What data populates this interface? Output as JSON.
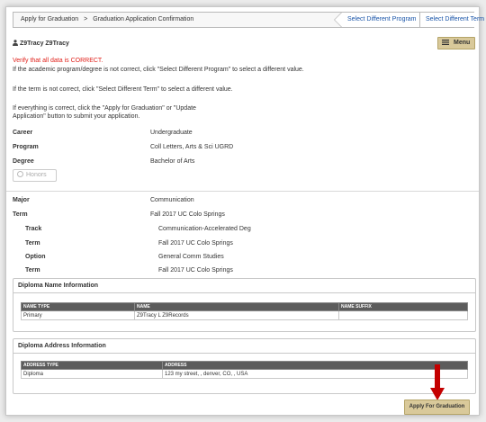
{
  "breadcrumb": {
    "parent": "Apply for Graduation",
    "separator": ">",
    "current": "Graduation Application Confirmation"
  },
  "tabs": {
    "select_program": "Select Different Program",
    "select_term": "Select Different Term"
  },
  "user": {
    "name": "Z9Tracy Z9Tracy",
    "icon": "person-icon"
  },
  "menu": {
    "label": "Menu",
    "icon": "hamburger-icon"
  },
  "messages": {
    "verify": "Verify that all data is CORRECT.",
    "program_hint": "If the academic program/degree is not correct, click \"Select Different Program\" to select a different value.",
    "term_hint": "If the term is not correct, click \"Select Different Term\" to select a different value.",
    "submit_hint_1": "If everything is correct, click the \"Apply for Graduation\" or \"Update",
    "submit_hint_2": "Application\" button to submit your application."
  },
  "program_info": {
    "career_label": "Career",
    "career_value": "Undergraduate",
    "program_label": "Program",
    "program_value": "Coll Letters, Arts & Sci UGRD",
    "degree_label": "Degree",
    "degree_value": "Bachelor of Arts"
  },
  "honors": {
    "label": "Honors"
  },
  "plan_info": {
    "major_label": "Major",
    "major_value": "Communication",
    "term_label": "Term",
    "term_value": "Fall 2017 UC Colo Springs",
    "track_label": "Track",
    "track_value": "Communication-Accelerated Deg",
    "track_term_label": "Term",
    "track_term_value": "Fall 2017 UC Colo Springs",
    "option_label": "Option",
    "option_value": "General Comm Studies",
    "option_term_label": "Term",
    "option_term_value": "Fall 2017 UC Colo Springs"
  },
  "diploma_name": {
    "title": "Diploma Name Information",
    "headers": [
      "NAME TYPE",
      "NAME",
      "NAME SUFFIX"
    ],
    "rows": [
      [
        "Primary",
        "Z9Tracy L Z9Records",
        ""
      ]
    ]
  },
  "diploma_address": {
    "title": "Diploma Address Information",
    "headers": [
      "ADDRESS TYPE",
      "ADDRESS"
    ],
    "rows": [
      [
        "Diploma",
        "123 my street, , denver, CO, , USA"
      ]
    ]
  },
  "apply_button": {
    "label": "Apply For Graduation"
  },
  "colors": {
    "accent_button": "#d9c99a",
    "link": "#1a55a8",
    "alert": "#e0211b",
    "annotation_arrow": "#c40000"
  }
}
